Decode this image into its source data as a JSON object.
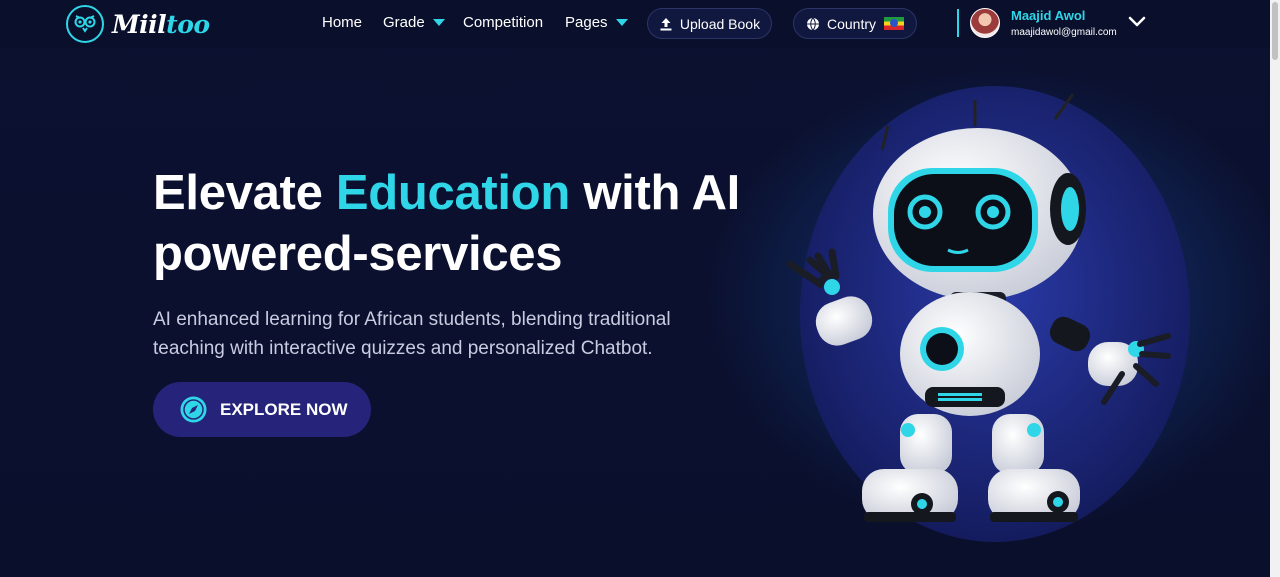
{
  "brand": {
    "logo_main": "Miil",
    "logo_accent": "too",
    "accent_color": "#2fd6e8"
  },
  "nav": {
    "home": "Home",
    "grade": "Grade",
    "competition": "Competition",
    "pages": "Pages",
    "upload_book": "Upload Book",
    "country": "Country"
  },
  "user": {
    "name": "Maajid Awol",
    "email": "maajidawol@gmail.com"
  },
  "hero": {
    "title_part1": "Elevate ",
    "title_highlight": "Education",
    "title_part2": " with AI powered-services",
    "subtitle": "AI enhanced learning for African students, blending traditional teaching with interactive quizzes and personalized Chatbot.",
    "cta_label": "EXPLORE NOW"
  },
  "icons": {
    "logo": "owl-icon",
    "upload": "upload-icon",
    "globe": "globe-icon",
    "flag": "ethiopia-flag-icon",
    "chevron": "chevron-down-icon",
    "cta": "compass-icon"
  },
  "colors": {
    "background": "#0b1030",
    "cta_background": "#25247a"
  }
}
